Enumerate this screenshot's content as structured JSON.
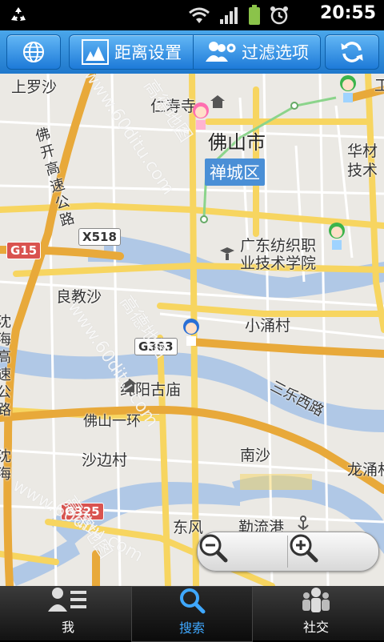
{
  "status_bar": {
    "time": "20:55",
    "icons": [
      "recycle-icon",
      "wifi-icon",
      "signal-icon",
      "battery-icon",
      "alarm-icon"
    ]
  },
  "toolbar": {
    "globe_icon": "globe-icon",
    "distance_label": "距离设置",
    "filter_label": "过滤选项",
    "refresh_icon": "refresh-icon"
  },
  "map": {
    "labels": {
      "shangluosha": "上罗沙",
      "renshou": "仁寿寺",
      "foshan_city": "佛山市",
      "huacai": "华材",
      "jishu": "技术",
      "foshan_highway": "佛开高速公路",
      "x518": "X518",
      "g15": "G15",
      "textile_school": "广东纺织职\n业技术学院",
      "liangjiaosha": "良教沙",
      "xiaoyongcun": "小涌村",
      "yanhai_highway": "沈海高速公路",
      "g363": "G363",
      "chunyang_temple": "纯阳古庙",
      "foshan_ring": "佛山一环",
      "sanle_west": "三乐西路",
      "shabiancun": "沙边村",
      "nansha": "南沙",
      "longyong": "龙涌村",
      "yanhai_highway_2": "沈海",
      "g325": "G325",
      "dongfeng": "东风",
      "leliugang": "勒流港",
      "gong": "工"
    },
    "district_label": "禅城区",
    "watermarks": [
      "www.60ditu.com",
      "高德地图",
      "www.60ditu.com",
      "高德地图",
      "www.60ditu.com",
      "高德地图"
    ],
    "zoom_out_icon": "zoom-out-icon",
    "zoom_in_icon": "zoom-in-icon"
  },
  "bottom_nav": {
    "items": [
      {
        "label": "我",
        "icon": "profile-list-icon",
        "active": false
      },
      {
        "label": "搜索",
        "icon": "search-icon",
        "active": true
      },
      {
        "label": "社交",
        "icon": "people-icon",
        "active": false
      }
    ]
  },
  "colors": {
    "toolbar_blue": "#1f78cc",
    "road_yellow": "#f7d560",
    "road_orange": "#e8a93a",
    "river": "#b0c8e6",
    "green_line": "#6fcf6f",
    "nav_active": "#3fa8ff"
  }
}
